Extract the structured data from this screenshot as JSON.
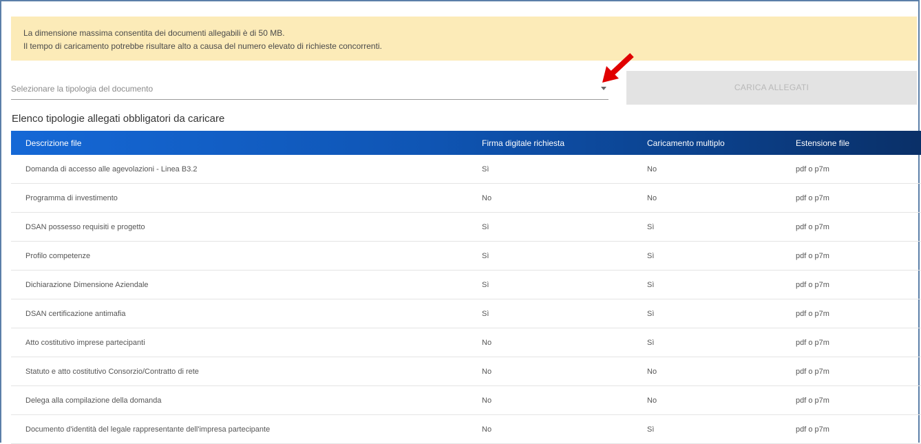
{
  "notice": {
    "line1": "La dimensione massima consentita dei documenti allegabili è di 50 MB.",
    "line2": "Il tempo di caricamento potrebbe risultare alto a causa del numero elevato di richieste concorrenti.",
    "background_color": "#fcebb8"
  },
  "document_type_select": {
    "placeholder": "Selezionare la tipologia del documento",
    "icon": "caret-down-icon"
  },
  "annotation": {
    "icon": "red-arrow-icon",
    "color": "#e00000"
  },
  "upload_button": {
    "label": "CARICA ALLEGATI",
    "state": "disabled"
  },
  "section_title": "Elenco tipologie allegati obbligatori da caricare",
  "table": {
    "header_color": "#1568d6",
    "columns": [
      "Descrizione file",
      "Firma digitale richiesta",
      "Caricamento multiplo",
      "Estensione file"
    ],
    "rows": [
      [
        "Domanda di accesso alle agevolazioni - Linea B3.2",
        "Sì",
        "No",
        "pdf o p7m"
      ],
      [
        "Programma di investimento",
        "No",
        "No",
        "pdf o p7m"
      ],
      [
        "DSAN possesso requisiti e progetto",
        "Sì",
        "Sì",
        "pdf o p7m"
      ],
      [
        "Profilo competenze",
        "Sì",
        "Sì",
        "pdf o p7m"
      ],
      [
        "Dichiarazione Dimensione Aziendale",
        "Sì",
        "Sì",
        "pdf o p7m"
      ],
      [
        "DSAN certificazione antimafia",
        "Sì",
        "Sì",
        "pdf o p7m"
      ],
      [
        "Atto costitutivo imprese partecipanti",
        "No",
        "Sì",
        "pdf o p7m"
      ],
      [
        "Statuto e atto costitutivo Consorzio/Contratto di rete",
        "No",
        "No",
        "pdf o p7m"
      ],
      [
        "Delega alla compilazione della domanda",
        "No",
        "No",
        "pdf o p7m"
      ],
      [
        "Documento d'identità del legale rappresentante dell'impresa partecipante",
        "No",
        "Sì",
        "pdf o p7m"
      ]
    ]
  }
}
